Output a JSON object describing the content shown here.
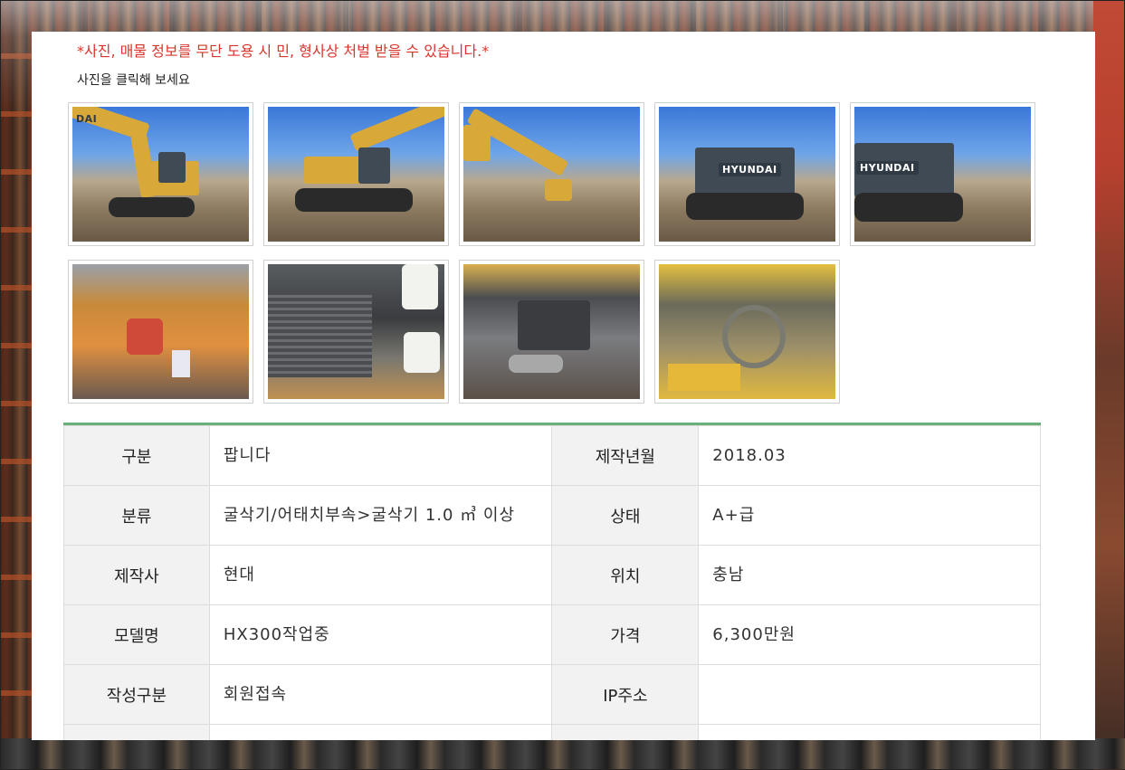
{
  "notice": {
    "warning": "*사진, 매물 정보를 무단 도용 시 민, 형사상 처벌 받을 수 있습니다.*",
    "hint": "사진을 클릭해 보세요"
  },
  "gallery": {
    "brand_text": "HYUNDAI",
    "brand_text_partial": "DAI"
  },
  "spec": {
    "rows": [
      {
        "label1": "구분",
        "value1": "팝니다",
        "label2": "제작년월",
        "value2": "2018.03"
      },
      {
        "label1": "분류",
        "value1": "굴삭기/어태치부속>굴삭기 1.0 ㎥ 이상",
        "label2": "상태",
        "value2": "A+급"
      },
      {
        "label1": "제작사",
        "value1": "현대",
        "label2": "위치",
        "value2": "충남"
      },
      {
        "label1": "모델명",
        "value1": "HX300작업중",
        "label2": "가격",
        "value2": "6,300만원"
      },
      {
        "label1": "작성구분",
        "value1": "회원접속",
        "label2": "IP주소",
        "value2": ""
      },
      {
        "label1": "",
        "value1": "",
        "label2": "",
        "value2": ""
      }
    ]
  },
  "colors": {
    "warning": "#d9342b",
    "table_accent": "#6ab07a",
    "header_cell_bg": "#f2f2f2"
  }
}
